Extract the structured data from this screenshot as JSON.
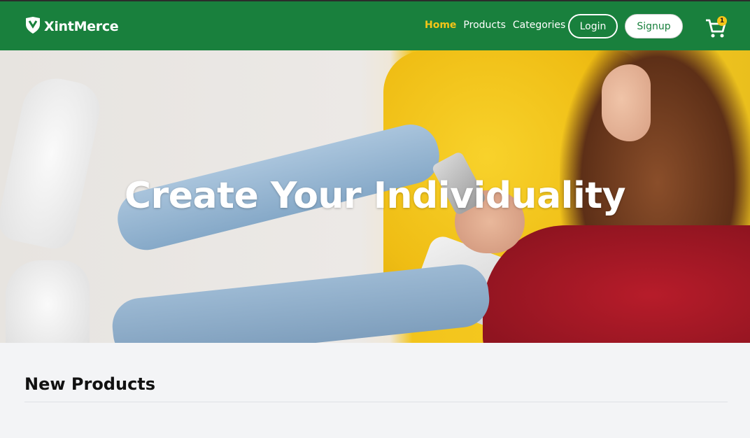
{
  "brand": {
    "name": "XintMerce",
    "icon": "shield-logo-icon"
  },
  "nav": {
    "links": [
      {
        "label": "Home",
        "active": true
      },
      {
        "label": "Products",
        "active": false
      },
      {
        "label": "Categories",
        "active": false
      }
    ],
    "login_label": "Login",
    "signup_label": "Signup",
    "cart": {
      "icon": "cart-icon",
      "count": "1"
    }
  },
  "hero": {
    "title": "Create Your Individuality"
  },
  "section": {
    "title": "New Products"
  },
  "colors": {
    "primary": "#19803d",
    "accent": "#f5c518",
    "background": "#f3f4f6"
  }
}
